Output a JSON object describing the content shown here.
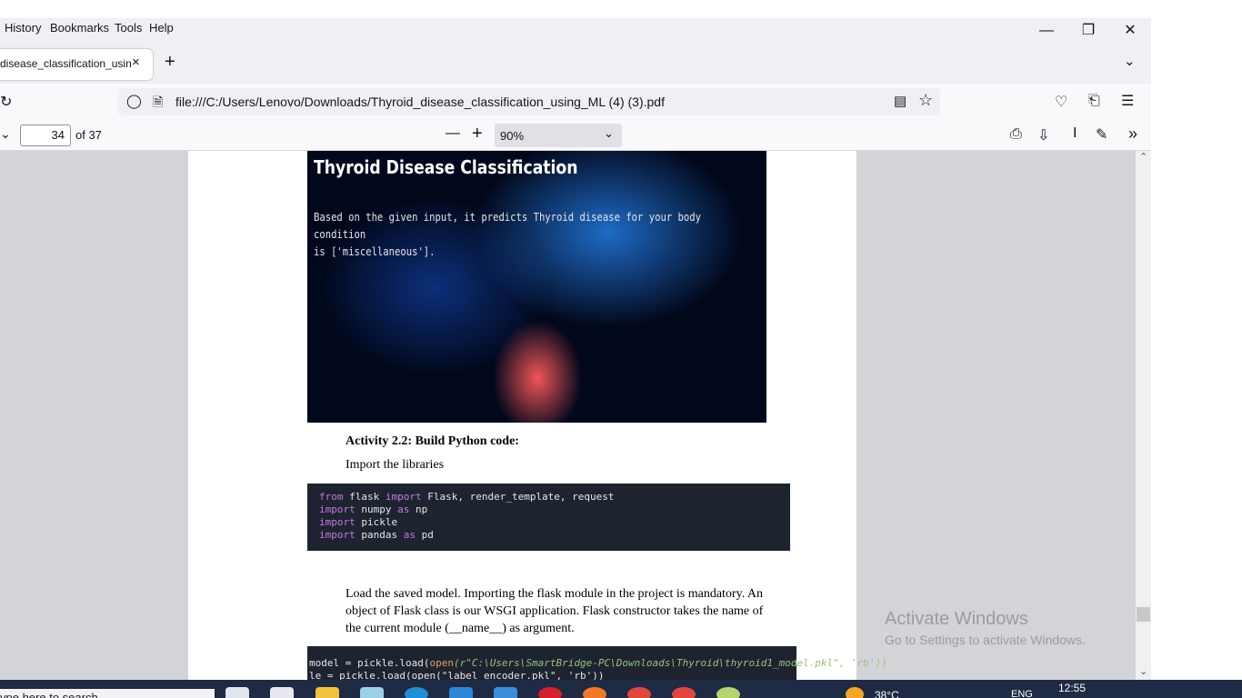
{
  "menubar": {
    "items": [
      "History",
      "Bookmarks",
      "Tools",
      "Help"
    ],
    "accel": [
      "i",
      "B",
      "T",
      "H"
    ]
  },
  "tab": {
    "title": "disease_classification_using_ML",
    "close": "×",
    "new_tab": "+"
  },
  "navbar": {
    "url": "file:///C:/Users/Lenovo/Downloads/Thyroid_disease_classification_using_ML (4) (3).pdf"
  },
  "pdf_toolbar": {
    "page_number": "34",
    "page_count_text": "of 37",
    "zoom": "90%"
  },
  "document": {
    "hero_title": "Thyroid Disease Classification",
    "hero_text_line1": "Based on the given input, it predicts Thyroid disease for your body condition",
    "hero_text_line2": "is ['miscellaneous'].",
    "activity_title": "Activity 2.2: Build Python code:",
    "activity_subtitle": "Import the libraries",
    "paragraph_line1": "Load the saved model. Importing the flask module in the project is mandatory. An",
    "paragraph_line2": "object of Flask class is our WSGI application. Flask constructor takes the name of",
    "paragraph_line3": "the current module (__name__) as argument.",
    "code2_line1_a": "model = pickle.load(",
    "code2_line1_b": "open",
    "code2_line1_c": "(r\"C:\\Users\\SmartBridge-PC\\Downloads\\Thyroid\\thyroid1_model.pkl\", 'rb'))",
    "code2_line2": "le = pickle.load(open(\"label_encoder.pkl\", 'rb'))"
  },
  "code1": {
    "l1_kw1": "from",
    "l1_mid": " flask ",
    "l1_kw2": "import",
    "l1_rest": " Flask, render_template, request",
    "l2_kw1": "import",
    "l2_mid": " numpy ",
    "l2_kw2": "as",
    "l2_rest": " np",
    "l3_kw1": "import",
    "l3_rest": " pickle",
    "l4_kw1": "import",
    "l4_mid": " pandas ",
    "l4_kw2": "as",
    "l4_rest": " pd"
  },
  "watermark": {
    "line1": "Activate Windows",
    "line2": "Go to Settings to activate Windows."
  },
  "taskbar": {
    "search_placeholder": "ype here to search",
    "temperature": "38°C",
    "language": "ENG",
    "time": "12:55"
  },
  "colors": {
    "accent_keyword": "#c678dd",
    "code_bg": "#1d2430",
    "viewer_bg": "#d4d4d8"
  }
}
